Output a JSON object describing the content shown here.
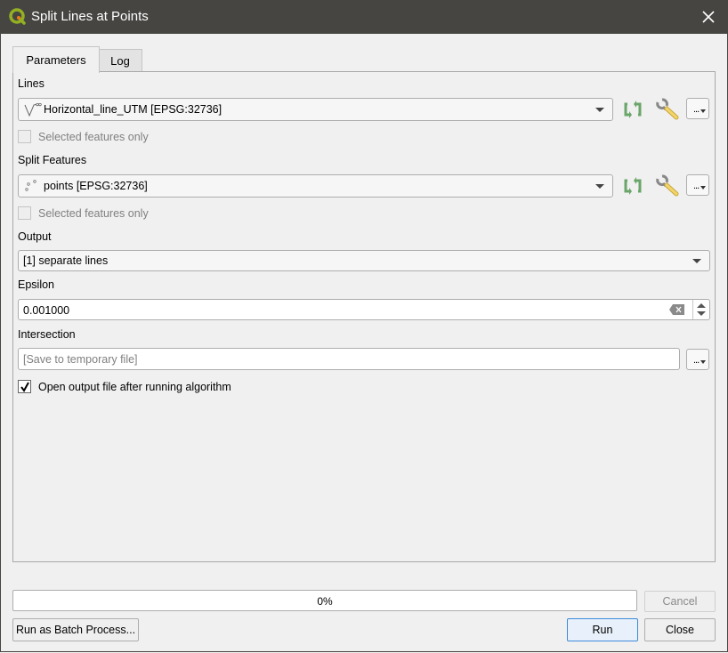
{
  "window": {
    "title": "Split Lines at Points",
    "close_icon": "close-icon",
    "app_icon": "qgis-logo-icon"
  },
  "tabs": [
    {
      "label": "Parameters",
      "active": true
    },
    {
      "label": "Log",
      "active": false
    }
  ],
  "parameters": {
    "lines": {
      "label": "Lines",
      "value": "Horizontal_line_UTM [EPSG:32736]",
      "layer_icon": "line-layer-icon",
      "selected_only_label": "Selected features only",
      "selected_only_checked": false,
      "iterate_icon": "iterate-icon",
      "settings_icon": "wrench-icon",
      "more_label": "..."
    },
    "split_features": {
      "label": "Split Features",
      "value": "points [EPSG:32736]",
      "layer_icon": "point-layer-icon",
      "selected_only_label": "Selected features only",
      "selected_only_checked": false,
      "iterate_icon": "iterate-icon",
      "settings_icon": "wrench-icon",
      "more_label": "..."
    },
    "output": {
      "label": "Output",
      "value": "[1] separate lines"
    },
    "epsilon": {
      "label": "Epsilon",
      "value": "0.001000"
    },
    "intersection": {
      "label": "Intersection",
      "placeholder": "[Save to temporary file]",
      "value": "",
      "more_label": "..."
    },
    "open_output": {
      "label": "Open output file after running algorithm",
      "checked": true
    }
  },
  "footer": {
    "progress_text": "0%",
    "progress_value": 0,
    "cancel_label": "Cancel",
    "batch_label": "Run as Batch Process...",
    "run_label": "Run",
    "close_label": "Close"
  }
}
